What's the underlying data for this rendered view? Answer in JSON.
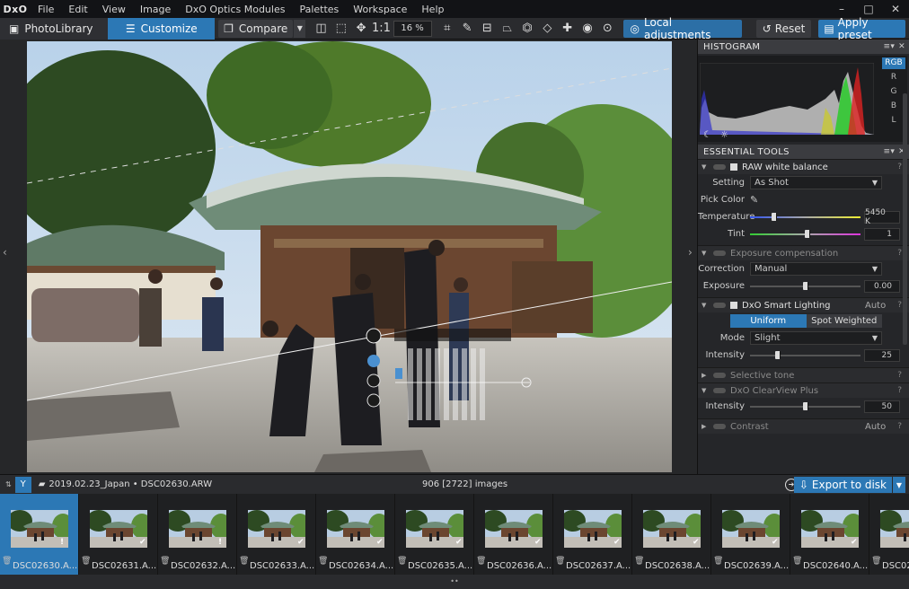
{
  "app": {
    "logo": "DxO",
    "menu": [
      "File",
      "Edit",
      "View",
      "Image",
      "DxO Optics Modules",
      "Palettes",
      "Workspace",
      "Help"
    ],
    "window_controls": [
      "–",
      "□",
      "✕"
    ]
  },
  "toolbar": {
    "photolibrary": "PhotoLibrary",
    "customize": "Customize",
    "compare": "Compare",
    "zoom_1_1": "1:1",
    "zoom_level": "16 %",
    "local_adjustments": "Local adjustments",
    "reset": "Reset",
    "apply_preset": "Apply preset"
  },
  "histogram": {
    "title": "HISTOGRAM",
    "channels": [
      "RGB",
      "R",
      "G",
      "B",
      "L"
    ],
    "active_channel": "RGB"
  },
  "essential_tools": {
    "title": "ESSENTIAL TOOLS",
    "raw_wb": {
      "title": "RAW white balance",
      "setting_label": "Setting",
      "setting_value": "As Shot",
      "pick_color_label": "Pick Color",
      "temperature_label": "Temperature",
      "temperature_value": "5450 K",
      "tint_label": "Tint",
      "tint_value": "1",
      "temperature_pos": 0.22,
      "tint_pos": 0.52
    },
    "exposure": {
      "title": "Exposure compensation",
      "correction_label": "Correction",
      "correction_value": "Manual",
      "exposure_label": "Exposure",
      "exposure_value": "0.00",
      "exposure_pos": 0.5
    },
    "smart_lighting": {
      "title": "DxO Smart Lighting",
      "auto": "Auto",
      "uniform": "Uniform",
      "spot_weighted": "Spot Weighted",
      "mode_label": "Mode",
      "mode_value": "Slight",
      "intensity_label": "Intensity",
      "intensity_value": "25",
      "intensity_pos": 0.25
    },
    "selective_tone": {
      "title": "Selective tone"
    },
    "clearview": {
      "title": "DxO ClearView Plus",
      "intensity_label": "Intensity",
      "intensity_value": "50",
      "intensity_pos": 0.5
    },
    "contrast": {
      "title": "Contrast",
      "auto": "Auto"
    }
  },
  "filmbar": {
    "path": "2019.02.23_Japan • DSC02630.ARW",
    "count": "906 [2722] images",
    "export": "Export to disk"
  },
  "thumbnails": [
    {
      "name": "DSC02630.A...",
      "badge": "!",
      "selected": true
    },
    {
      "name": "DSC02631.A...",
      "badge": "✔",
      "selected": false
    },
    {
      "name": "DSC02632.A...",
      "badge": "!",
      "selected": false
    },
    {
      "name": "DSC02633.A...",
      "badge": "✔",
      "selected": false
    },
    {
      "name": "DSC02634.A...",
      "badge": "✔",
      "selected": false
    },
    {
      "name": "DSC02635.A...",
      "badge": "✔",
      "selected": false
    },
    {
      "name": "DSC02636.A...",
      "badge": "✔",
      "selected": false
    },
    {
      "name": "DSC02637.A...",
      "badge": "✔",
      "selected": false
    },
    {
      "name": "DSC02638.A...",
      "badge": "✔",
      "selected": false
    },
    {
      "name": "DSC02639.A...",
      "badge": "✔",
      "selected": false
    },
    {
      "name": "DSC02640.A...",
      "badge": "✔",
      "selected": false
    },
    {
      "name": "DSC02",
      "badge": "",
      "selected": false
    }
  ]
}
